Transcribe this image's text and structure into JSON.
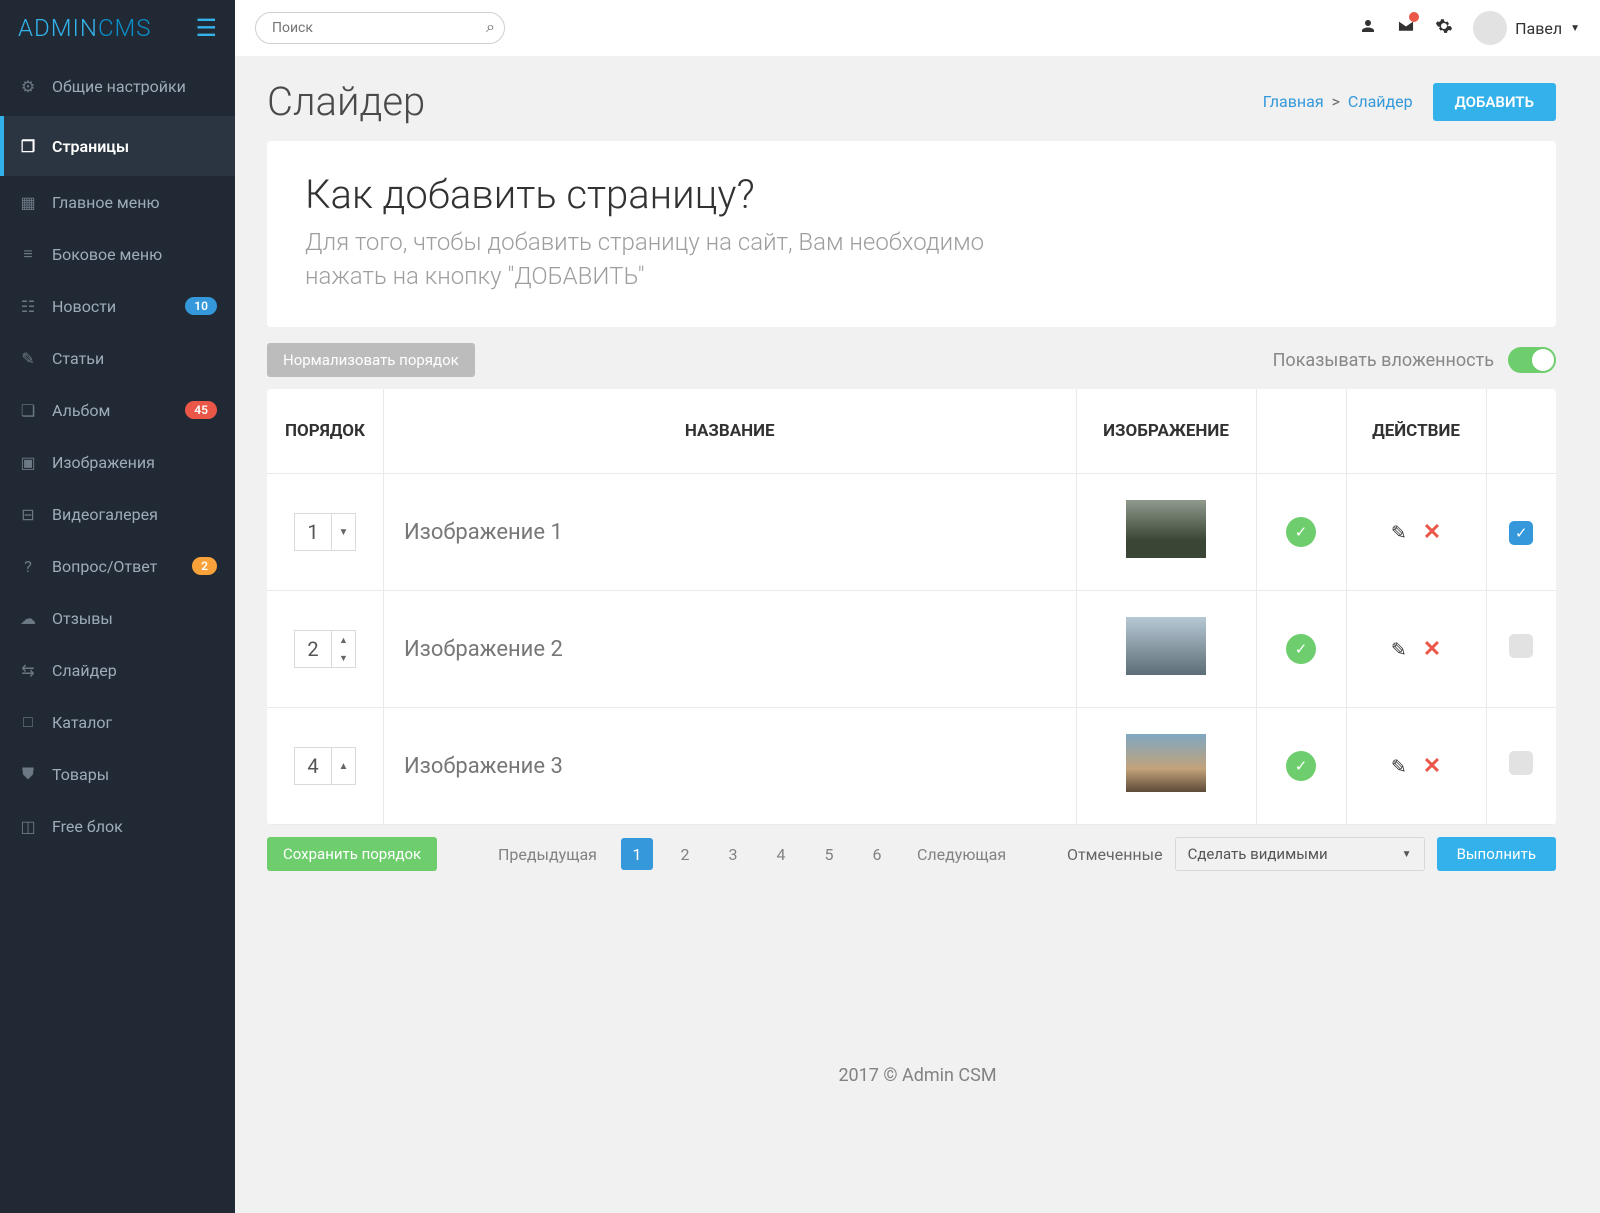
{
  "brand": {
    "a": "ADMIN",
    "b": "CMS"
  },
  "search": {
    "placeholder": "Поиск"
  },
  "user": {
    "name": "Павел",
    "caret": "▼"
  },
  "sidebar": {
    "items": [
      {
        "label": "Общие настройки"
      },
      {
        "label": "Страницы"
      },
      {
        "label": "Главное меню"
      },
      {
        "label": "Боковое меню"
      },
      {
        "label": "Новости",
        "badge": "10"
      },
      {
        "label": "Статьи"
      },
      {
        "label": "Альбом",
        "badge": "45"
      },
      {
        "label": "Изображения"
      },
      {
        "label": "Видеогалерея"
      },
      {
        "label": "Вопрос/Ответ",
        "badge": "2"
      },
      {
        "label": "Отзывы"
      },
      {
        "label": "Слайдер"
      },
      {
        "label": "Каталог"
      },
      {
        "label": "Товары"
      },
      {
        "label": "Free блок"
      }
    ]
  },
  "page": {
    "title": "Слайдер"
  },
  "breadcrumb": {
    "home": "Главная",
    "current": "Слайдер",
    "sep": ">"
  },
  "buttons": {
    "add": "ДОБАВИТЬ",
    "normalize": "Нормализовать порядок",
    "saveOrder": "Сохранить порядок",
    "execute": "Выполнить"
  },
  "help": {
    "title": "Как добавить страницу?",
    "text": "Для того, чтобы добавить страницу на сайт, Вам необходимо нажать на кнопку \"ДОБАВИТЬ\""
  },
  "toggle": {
    "label": "Показывать вложенность"
  },
  "table": {
    "headers": {
      "order": "ПОРЯДОК",
      "name": "НАЗВАНИЕ",
      "image": "ИЗОБРАЖЕНИЕ",
      "action": "ДЕЙСТВИЕ"
    },
    "rows": [
      {
        "order": "1",
        "name": "Изображение 1",
        "handle": "down",
        "checked": true
      },
      {
        "order": "2",
        "name": "Изображение 2",
        "handle": "both",
        "checked": false
      },
      {
        "order": "4",
        "name": "Изображение 3",
        "handle": "up",
        "checked": false
      }
    ]
  },
  "pagination": {
    "prev": "Предыдущая",
    "next": "Следующая",
    "pages": [
      "1",
      "2",
      "3",
      "4",
      "5",
      "6"
    ],
    "active": "1"
  },
  "bulk": {
    "label": "Отмеченные",
    "selected": "Сделать видимыми",
    "caret": "▼"
  },
  "footer": {
    "text": "2017 © Admin CSM"
  }
}
